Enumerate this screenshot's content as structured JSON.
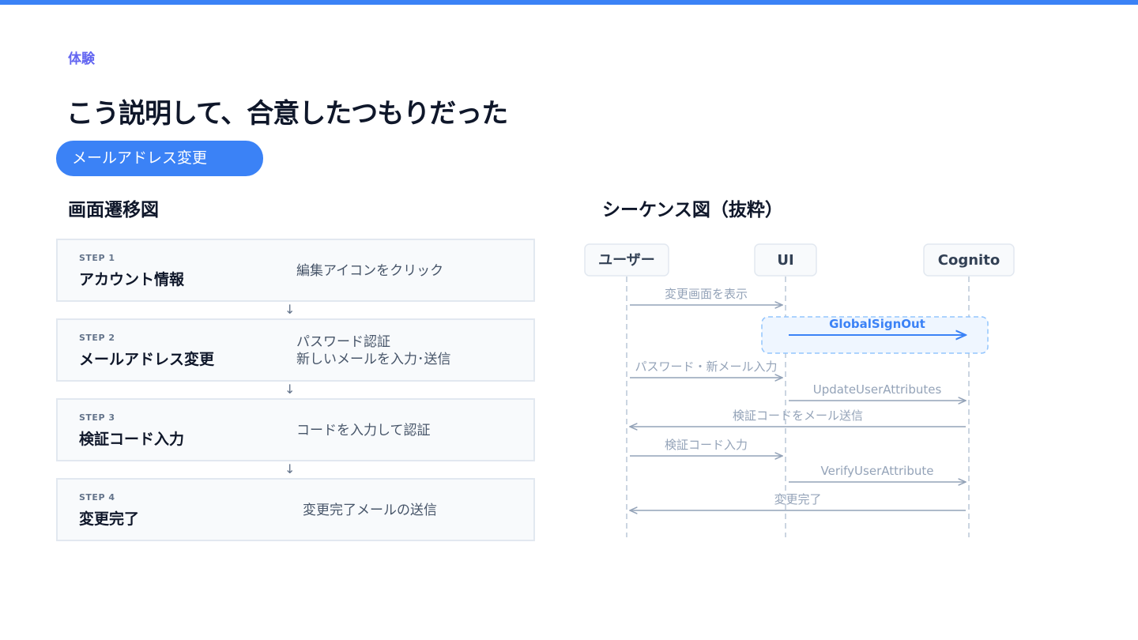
{
  "header": {
    "category": "体験",
    "title": "こう説明して、合意したつもりだった",
    "tag": "メールアドレス変更"
  },
  "flow": {
    "title": "画面遷移図",
    "steps": [
      {
        "label": "STEP 1",
        "title": "アカウント情報",
        "desc": [
          "編集アイコンをクリック"
        ]
      },
      {
        "label": "STEP 2",
        "title": "メールアドレス変更",
        "desc": [
          "パスワード認証",
          "新しいメールを入力･送信"
        ]
      },
      {
        "label": "STEP 3",
        "title": "検証コード入力",
        "desc": [
          "コードを入力して認証"
        ]
      },
      {
        "label": "STEP 4",
        "title": "変更完了",
        "desc": [
          "変更完了メールの送信"
        ]
      }
    ],
    "arrow": "↓"
  },
  "sequence": {
    "title": "シーケンス図（抜粋）",
    "actors": [
      "ユーザー",
      "UI",
      "Cognito"
    ],
    "messages": [
      {
        "from": 0,
        "to": 1,
        "label": "変更画面を表示"
      },
      {
        "from": 1,
        "to": 2,
        "label": "GlobalSignOut",
        "highlight": true
      },
      {
        "from": 0,
        "to": 1,
        "label": "パスワード・新メール入力"
      },
      {
        "from": 1,
        "to": 2,
        "label": "UpdateUserAttributes"
      },
      {
        "from": 2,
        "to": 0,
        "label": "検証コードをメール送信"
      },
      {
        "from": 0,
        "to": 1,
        "label": "検証コード入力"
      },
      {
        "from": 1,
        "to": 2,
        "label": "VerifyUserAttribute"
      },
      {
        "from": 2,
        "to": 0,
        "label": "変更完了"
      }
    ],
    "colors": {
      "line": "#94a3b8",
      "highlight": "#3b82f6",
      "highlight_bg": "#eff6ff",
      "lifeline": "#cbd5e1"
    }
  }
}
